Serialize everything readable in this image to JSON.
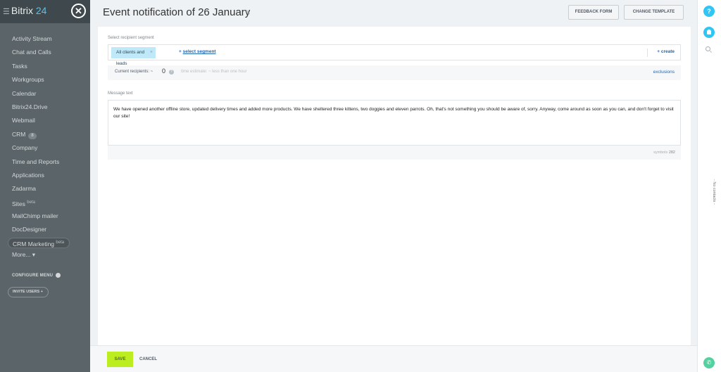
{
  "sidebar": {
    "logo_prefix": "Bitrix",
    "logo_suffix": "24",
    "close_glyph": "✕",
    "items": [
      {
        "label": "Activity Stream"
      },
      {
        "label": "Chat and Calls"
      },
      {
        "label": "Tasks"
      },
      {
        "label": "Workgroups"
      },
      {
        "label": "Calendar"
      },
      {
        "label": "Bitrix24.Drive"
      },
      {
        "label": "Webmail"
      },
      {
        "label": "CRM",
        "counter": "8"
      },
      {
        "label": "Company"
      },
      {
        "label": "Time and Reports"
      },
      {
        "label": "Applications"
      },
      {
        "label": "Zadarma"
      },
      {
        "label": "Sites",
        "beta": "beta"
      },
      {
        "label": "MailChimp mailer"
      },
      {
        "label": "DocDesigner"
      },
      {
        "label": "CRM Marketing",
        "beta": "beta",
        "active": true
      },
      {
        "label": "More... ▾"
      }
    ],
    "configure_menu": "CONFIGURE MENU",
    "invite_users": "INVITE USERS  +"
  },
  "header": {
    "title": "Event notification of 26 January",
    "feedback_form": "FEEDBACK FORM",
    "change_template": "CHANGE TEMPLATE"
  },
  "segment": {
    "label": "Select recipient segment",
    "chip": "All clients and leads",
    "select_prefix": "+ ",
    "select_link": "select segment",
    "create": "+ create"
  },
  "recipients": {
    "label": "Current recipients: ~",
    "count": "0",
    "estimate": "time estimate: ~ less than one hour",
    "exclusions": "exclusions"
  },
  "message": {
    "label": "Message text",
    "text": "We have opened another offline store, updated delivery times and added more products. We have sheltered three kittens, two doggies and eleven parrots. Oh, that's not something you should be aware of, sorry. Anyway, come around as soon as you can, and don't forget to visit our site!",
    "symbols_label": "symbols",
    "symbols_count": "282"
  },
  "footer": {
    "save": "SAVE",
    "cancel": "CANCEL"
  },
  "rightbar": {
    "help": "?",
    "no_contacts": "- No contacts -",
    "phone": "✆"
  },
  "colors": {
    "accent": "#2fc6f6",
    "save": "#bbed21",
    "link": "#2067b0"
  }
}
